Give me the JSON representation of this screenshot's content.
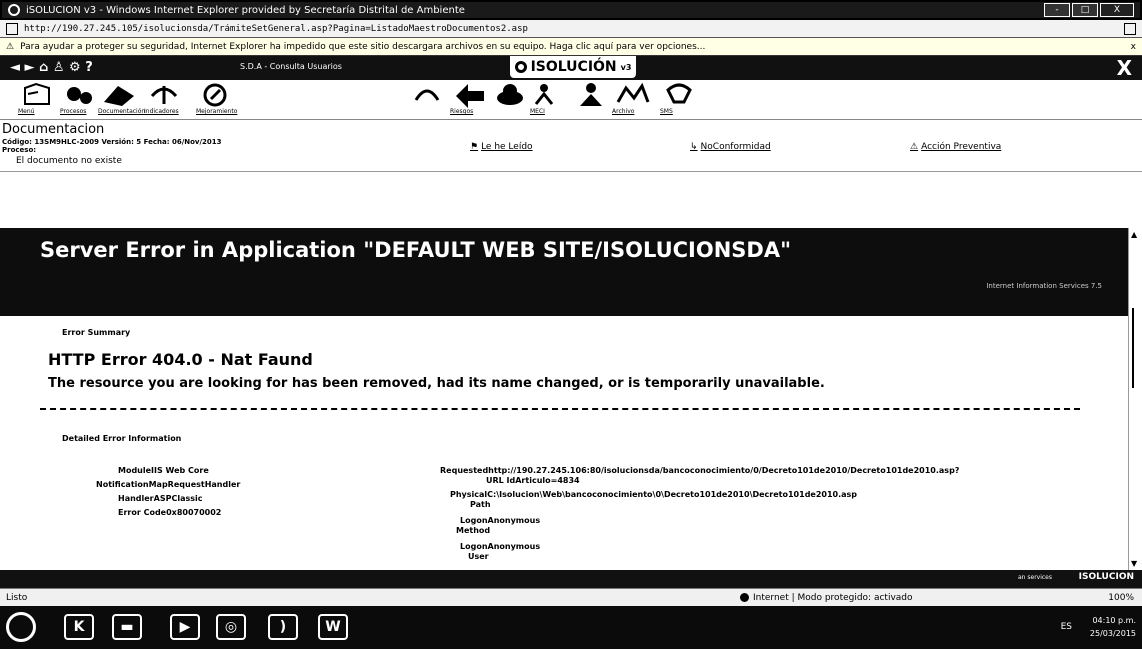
{
  "window": {
    "title": "iSOLUCIÓN v3 ",
    "browser": "Windows Internet Explorer provided by Secretaría Distrital de Ambiente",
    "url": "http://190.27.245.105/isolucionsda/TrámiteSetGeneral.asp?Pagina=ListadoMaestroDocumentos2.asp",
    "min": "-",
    "max": "□",
    "close": "X"
  },
  "infobar": {
    "message": "Para ayudar a proteger su seguridad, Internet Explorer ha impedido que este sitio descargara archivos en su equipo. Haga clic aquí para ver opciones...",
    "close": "x"
  },
  "appnav": {
    "nav_arrows": "◄ ► ⌂ ♙ ⚙ ?",
    "user": "S.D.A - Consulta Usuarios",
    "brand": "ISOLUCIÓN",
    "brand_sub": "v3",
    "close": "X"
  },
  "toolbar": {
    "labels": {
      "menu": "Menú",
      "procesos": "Procesos",
      "documentacion": "Documentación",
      "indicadores": "Indicadores",
      "mejoramiento": "Mejoramiento",
      "riesgos": "Riesgos",
      "mecl": "MECI",
      "archivo": "Archivo",
      "sms": "SMS"
    }
  },
  "doc": {
    "title": "Documentacion",
    "meta": "Código: 13SM9HLC-2009   Versión: 5   Fecha: 06/Nov/2013",
    "meta2": "Proceso:",
    "not_exist": "El documento no existe",
    "links": {
      "leido": "Le he Leído",
      "noconformidad": "NoConformidad",
      "accion": "Acción Preventiva"
    }
  },
  "error": {
    "banner_title": "Server Error in Application \"DEFAULT WEB SITE/ISOLUCIONSDA\"",
    "banner_sub": "Internet Information Services 7.5",
    "summary_label": "Error Summary",
    "http_error": "HTTP Error 404.0 - Nat Faund",
    "resource_msg": "The resource you are looking for has been removed, had its name changed, or is temporarily unavailable.",
    "detail_label": "Detailed Error Information",
    "left": [
      {
        "k": "Module",
        "v": "IIS Web Core"
      },
      {
        "k": "Notification",
        "v": "MapRequestHandler"
      },
      {
        "k": "Handler",
        "v": "ASPClassic"
      },
      {
        "k": "Error Code",
        "v": "0x80070002"
      }
    ],
    "right": [
      {
        "k": "Requested",
        "v": "http://190.27.245.106:80/isolucionsda/bancoconocimiento/0/Decreto101de2010/Decreto101de2010.asp?"
      },
      {
        "k": "",
        "v": "URL IdArticulo=4834"
      },
      {
        "k": "Physical",
        "v": "C:\\Isolucion\\Web\\bancoconocimiento\\0\\Decreto101de2010\\Decreto101de2010.asp"
      },
      {
        "k": "",
        "v": "Path"
      },
      {
        "k": "Logon",
        "v": "Anonymous"
      },
      {
        "k": "",
        "v": "Method"
      },
      {
        "k": "Logon",
        "v": "Anonymous"
      },
      {
        "k": "",
        "v": "User"
      }
    ]
  },
  "appstatus": {
    "left": "an services",
    "brand": "ISOLUCION"
  },
  "iestatus": {
    "ready": "Listo",
    "zone": "Internet | Modo protegido: activado",
    "zoom": "100%"
  },
  "taskbar": {
    "tray": "ES",
    "time": "04:10 p.m.",
    "date": "25/03/2015"
  }
}
